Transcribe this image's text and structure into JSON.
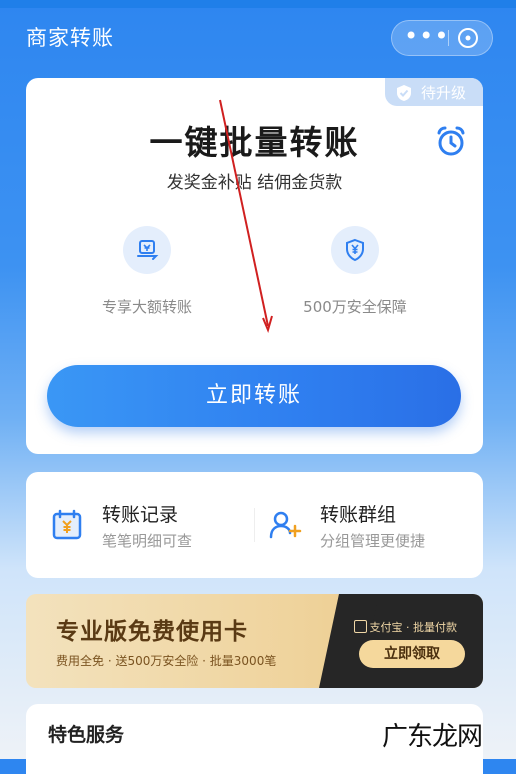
{
  "nav": {
    "title": "商家转账",
    "more_label": "•••"
  },
  "main": {
    "badge": "待升级",
    "headline": "一键批量转账",
    "subline": "发奖金补贴 结佣金货款",
    "features": [
      {
        "label": "专享大额转账"
      },
      {
        "label": "500万安全保障"
      }
    ],
    "cta_label": "立即转账"
  },
  "quick": [
    {
      "title": "转账记录",
      "subtitle": "笔笔明细可查"
    },
    {
      "title": "转账群组",
      "subtitle": "分组管理更便捷"
    }
  ],
  "promo": {
    "title": "专业版免费使用卡",
    "subtitle": "费用全免 · 送500万安全险 · 批量3000笔",
    "logo_text": "支付宝 · 批量付款",
    "button_label": "立即领取"
  },
  "services": {
    "title": "特色服务"
  },
  "watermark": "广东龙网",
  "colors": {
    "primary": "#2f7ff0",
    "promo_dark": "#262626",
    "promo_gold": "#f5d89c",
    "annotation_arrow": "#d02020"
  }
}
